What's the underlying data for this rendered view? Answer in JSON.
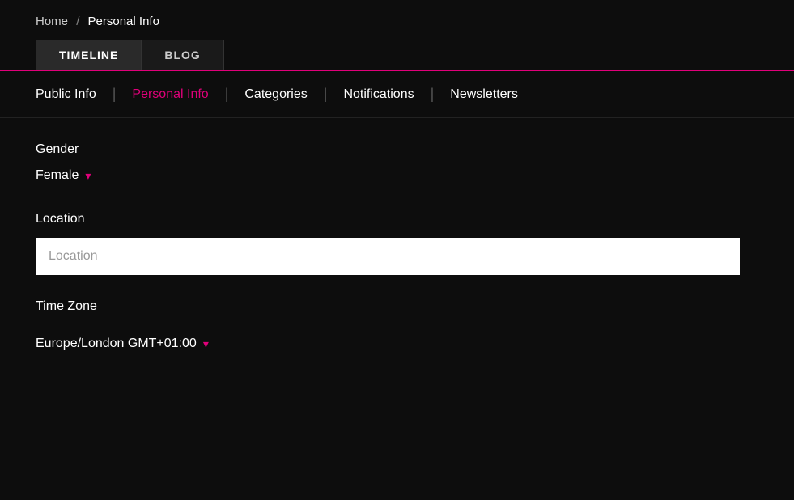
{
  "breadcrumb": {
    "home_label": "Home",
    "separator": "/",
    "current_label": "Personal Info"
  },
  "top_tabs": [
    {
      "id": "timeline",
      "label": "TIMELINE",
      "active": true
    },
    {
      "id": "blog",
      "label": "BLOG",
      "active": false
    }
  ],
  "sub_nav": {
    "items": [
      {
        "id": "public-info",
        "label": "Public Info",
        "active": false
      },
      {
        "id": "personal-info",
        "label": "Personal Info",
        "active": true
      },
      {
        "id": "categories",
        "label": "Categories",
        "active": false
      },
      {
        "id": "notifications",
        "label": "Notifications",
        "active": false
      },
      {
        "id": "newsletters",
        "label": "Newsletters",
        "active": false
      }
    ]
  },
  "form": {
    "gender_label": "Gender",
    "gender_value": "Female",
    "location_label": "Location",
    "location_placeholder": "Location",
    "timezone_label": "Time Zone",
    "timezone_value": "Europe/London GMT+01:00"
  },
  "colors": {
    "accent": "#e0007a",
    "background": "#0d0d0d",
    "text": "#ffffff"
  }
}
